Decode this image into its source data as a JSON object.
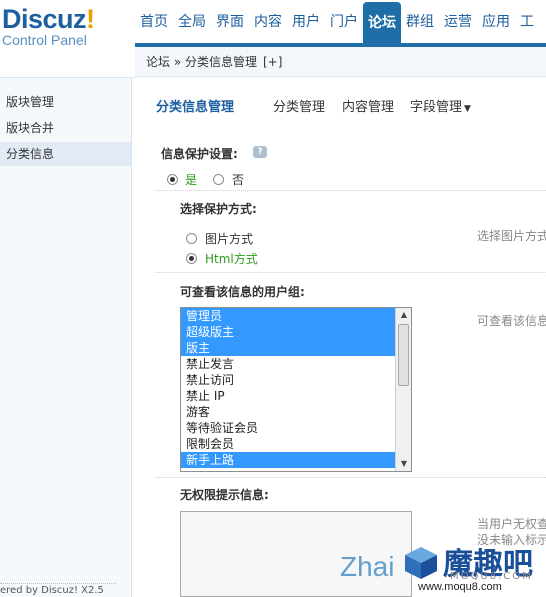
{
  "header": {
    "logo_main": "Discuz",
    "logo_excl": "!",
    "logo_sub": "Control Panel",
    "nav": [
      "首页",
      "全局",
      "界面",
      "内容",
      "用户",
      "门户",
      "论坛",
      "群组",
      "运营",
      "应用",
      "工"
    ],
    "active_nav": "论坛"
  },
  "breadcrumb": {
    "text": "论坛 » 分类信息管理",
    "add": "[+]"
  },
  "sidebar": {
    "items": [
      "版块管理",
      "版块合并",
      "分类信息"
    ],
    "active": "分类信息",
    "footer": "ered by Discuz! X2.5"
  },
  "subnav": {
    "title": "分类信息管理",
    "tabs": [
      "分类管理",
      "内容管理",
      "字段管理"
    ],
    "dropdown_arrow": "▼"
  },
  "form": {
    "protect_label": "信息保护设置:",
    "help_icon": "?",
    "yes": "是",
    "no": "否",
    "protect_selected": "是",
    "method_label": "选择保护方式:",
    "method_options": [
      "图片方式",
      "Html方式"
    ],
    "method_selected": "Html方式",
    "method_tip": "选择图片方式",
    "usergroup_label": "可查看该信息的用户组:",
    "usergroup_tip": "可查看该信息",
    "usergroups": [
      {
        "name": "管理员",
        "selected": true
      },
      {
        "name": "超级版主",
        "selected": true
      },
      {
        "name": "版主",
        "selected": true
      },
      {
        "name": "禁止发言",
        "selected": false
      },
      {
        "name": "禁止访问",
        "selected": false
      },
      {
        "name": "禁止 IP",
        "selected": false
      },
      {
        "name": "游客",
        "selected": false
      },
      {
        "name": "等待验证会员",
        "selected": false
      },
      {
        "name": "限制会员",
        "selected": false
      },
      {
        "name": "新手上路",
        "selected": true
      }
    ],
    "noperm_label": "无权限提示信息:",
    "noperm_value": "",
    "noperm_tip1": "当用户无权查",
    "noperm_tip2": "没未输入标示"
  },
  "watermark": {
    "left": "Zhai",
    "big": "魔趣吧",
    "small": "MOQU8.COM",
    "url": "www.moqu8.com"
  },
  "colors": {
    "brand_blue": "#1f6ea8",
    "selection_blue": "#3399ff",
    "green_option": "#2f9a1e"
  }
}
